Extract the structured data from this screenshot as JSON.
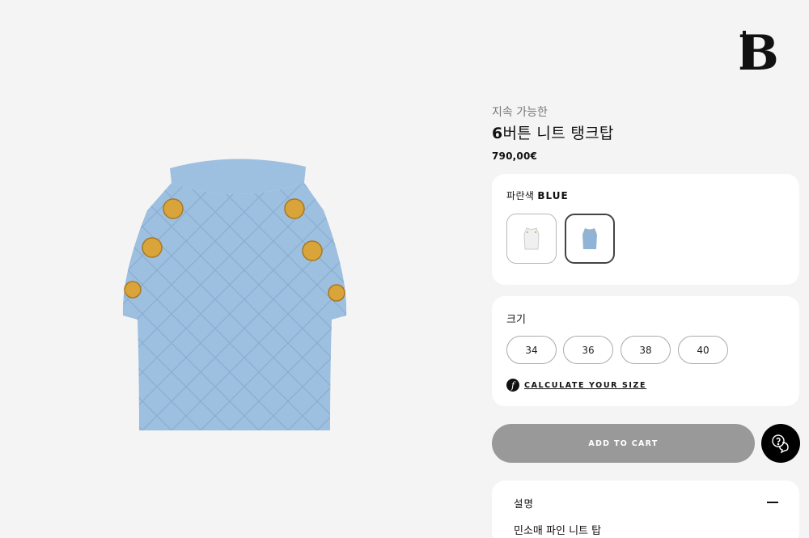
{
  "brand": {
    "logo_icon": "balmain-b-logo"
  },
  "product": {
    "sustainability": "지속 가능한",
    "title_num": "6",
    "title_rest": "버튼 니트 탱크탑",
    "price": "790,00€"
  },
  "color_section": {
    "label": "파란색",
    "color_name": "BLUE",
    "swatches": [
      {
        "icon": "white-tank-thumbnail",
        "color": "#f2f2f2"
      },
      {
        "icon": "blue-tank-thumbnail",
        "color": "#8fb4d8",
        "selected": true
      }
    ]
  },
  "size_section": {
    "label": "크기",
    "sizes": [
      "34",
      "36",
      "38",
      "40"
    ],
    "calc_icon_glyph": "f",
    "calc_link": "CALCULATE YOUR SIZE"
  },
  "actions": {
    "add_to_cart": "ADD TO CART",
    "help_icon": "chat-question-icon"
  },
  "description": {
    "title": "설명",
    "subtitle": "민소매 파인 니트 탑"
  },
  "colors": {
    "page_bg": "#f4f4f4",
    "card_bg": "#ffffff",
    "knit_blue": "#9dbfe0",
    "gold": "#d9a53a",
    "cart_gray": "#999999"
  }
}
